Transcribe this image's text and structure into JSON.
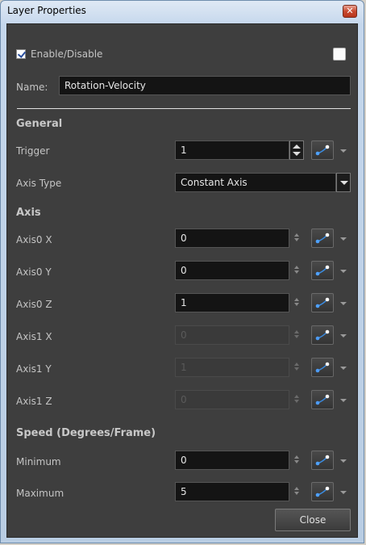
{
  "window": {
    "title": "Layer Properties"
  },
  "enable": {
    "label": "Enable/Disable",
    "checked": true
  },
  "name": {
    "label": "Name:",
    "value": "Rotation-Velocity"
  },
  "general": {
    "heading": "General",
    "trigger_label": "Trigger",
    "trigger_value": "1",
    "axis_type_label": "Axis Type",
    "axis_type_value": "Constant Axis"
  },
  "axis": {
    "heading": "Axis",
    "rows": [
      {
        "label": "Axis0 X",
        "value": "0",
        "enabled": true
      },
      {
        "label": "Axis0 Y",
        "value": "0",
        "enabled": true
      },
      {
        "label": "Axis0 Z",
        "value": "1",
        "enabled": true
      },
      {
        "label": "Axis1 X",
        "value": "0",
        "enabled": false
      },
      {
        "label": "Axis1 Y",
        "value": "1",
        "enabled": false
      },
      {
        "label": "Axis1 Z",
        "value": "0",
        "enabled": false
      }
    ]
  },
  "speed": {
    "heading": "Speed (Degrees/Frame)",
    "minimum_label": "Minimum",
    "minimum_value": "0",
    "maximum_label": "Maximum",
    "maximum_value": "5"
  },
  "footer": {
    "close_label": "Close"
  },
  "icons": {
    "function": "function-curve-icon"
  },
  "colors": {
    "panel_bg": "#3e3e3e",
    "field_bg": "#141414",
    "curve_blue": "#3a8ee6"
  }
}
